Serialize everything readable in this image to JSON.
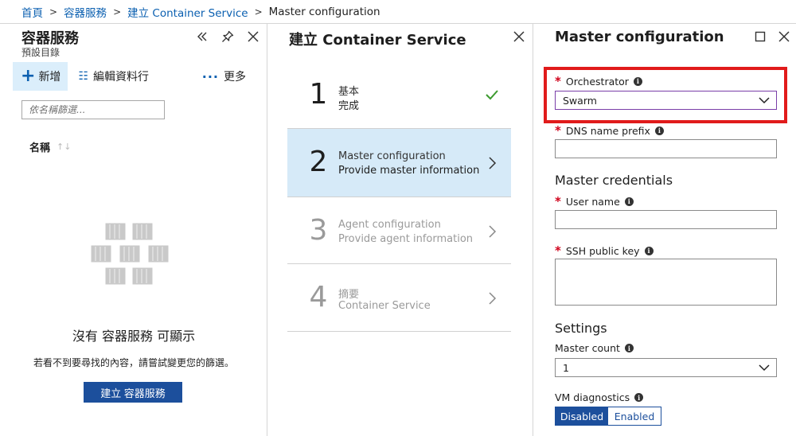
{
  "breadcrumb": {
    "items": [
      "首頁",
      "容器服務",
      "建立 Container Service"
    ],
    "current": "Master configuration"
  },
  "left_blade": {
    "title": "容器服務",
    "subtitle": "預設目錄",
    "commands": {
      "new": "新增",
      "edit_columns": "編輯資料行",
      "more": "更多"
    },
    "filter_placeholder": "依名稱篩選...",
    "column_header": "名稱",
    "empty_title": "沒有 容器服務 可顯示",
    "empty_hint": "若看不到要尋找的內容，請嘗試變更您的篩選。",
    "create_button": "建立 容器服務"
  },
  "middle_blade": {
    "title": "建立 Container Service",
    "steps": [
      {
        "number": "1",
        "title": "基本",
        "subtitle": "完成",
        "state": "completed"
      },
      {
        "number": "2",
        "title": "Master configuration",
        "subtitle": "Provide master information",
        "state": "active"
      },
      {
        "number": "3",
        "title": "Agent configuration",
        "subtitle": "Provide agent information",
        "state": "disabled"
      },
      {
        "number": "4",
        "title": "摘要",
        "subtitle": "Container Service",
        "state": "disabled"
      }
    ]
  },
  "right_blade": {
    "title": "Master configuration",
    "orchestrator": {
      "label": "Orchestrator",
      "value": "Swarm",
      "required": true
    },
    "dns_prefix": {
      "label": "DNS name prefix",
      "value": "",
      "required": true
    },
    "credentials_heading": "Master credentials",
    "user_name": {
      "label": "User name",
      "value": "",
      "required": true
    },
    "ssh_key": {
      "label": "SSH public key",
      "value": "",
      "required": true
    },
    "settings_heading": "Settings",
    "master_count": {
      "label": "Master count",
      "value": "1"
    },
    "vm_diagnostics": {
      "label": "VM diagnostics",
      "options": [
        "Disabled",
        "Enabled"
      ],
      "selected": "Disabled"
    }
  },
  "colors": {
    "accent": "#1c4f9c",
    "link": "#0a5fb0",
    "active_step_bg": "#d6eaf8",
    "required": "#d0021b",
    "highlight_border": "#e11b1b",
    "success": "#3c9a2e"
  }
}
